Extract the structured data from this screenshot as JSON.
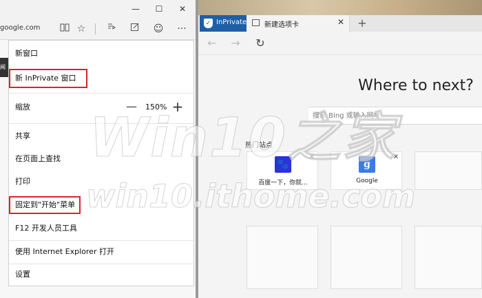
{
  "left_window": {
    "address_text": "google.com",
    "side_sliver_text": "闻",
    "controls": {
      "minimize": "—",
      "maximize": "☐",
      "close": "✕"
    },
    "toolbar_icons": [
      "reading-view-icon",
      "favorite-star-icon",
      "hub-icon",
      "web-note-icon",
      "feedback-smiley-icon",
      "more-icon"
    ]
  },
  "menu": {
    "new_window": "新窗口",
    "new_inprivate": "新 InPrivate 窗口",
    "zoom_label": "缩放",
    "zoom_minus": "—",
    "zoom_value": "150%",
    "zoom_plus": "+",
    "share": "共享",
    "find_on_page": "在页面上查找",
    "print": "打印",
    "pin_to_start": "固定到\"开始\"菜单",
    "devtools": "F12 开发人员工具",
    "open_with_ie": "使用 Internet Explorer 打开",
    "settings": "设置",
    "highlight_color": "#e0202a"
  },
  "right_window": {
    "inprivate_tab_label": "InPrivate",
    "new_tab_label": "新建选项卡",
    "tab_close": "✕",
    "tab_add": "+",
    "accent_color": "#1e5fa8",
    "heading": "Where to next?",
    "search_placeholder": "搜索 Bing 或输入网址",
    "top_sites_label": "热门站点",
    "sites": [
      {
        "name": "百度一下，你就...",
        "icon": "baidu-paw-icon",
        "glyph": "🐾",
        "color": "#2b32d8"
      },
      {
        "name": "Google",
        "icon": "google-g-icon",
        "glyph": "g",
        "color": "#3b7be8"
      }
    ],
    "tile_close": "✕"
  },
  "watermark": {
    "line1": "Win10之家",
    "line2": "win10.ithome.com"
  }
}
